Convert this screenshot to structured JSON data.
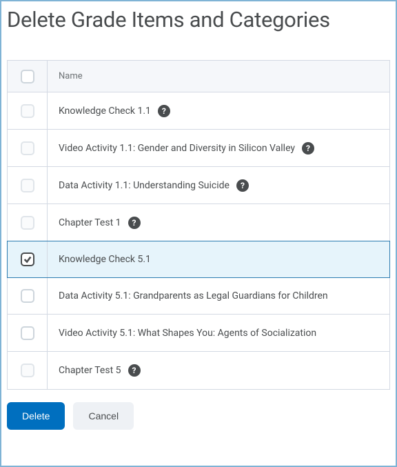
{
  "title": "Delete Grade Items and Categories",
  "table": {
    "header": {
      "name_label": "Name"
    },
    "rows": [
      {
        "label": "Knowledge Check 1.1",
        "checked": false,
        "disabled": true,
        "help": true
      },
      {
        "label": "Video Activity 1.1: Gender and Diversity in Silicon Valley",
        "checked": false,
        "disabled": true,
        "help": true
      },
      {
        "label": "Data Activity 1.1: Understanding Suicide",
        "checked": false,
        "disabled": true,
        "help": true
      },
      {
        "label": "Chapter Test 1",
        "checked": false,
        "disabled": true,
        "help": true
      },
      {
        "label": "Knowledge Check 5.1",
        "checked": true,
        "disabled": false,
        "help": false
      },
      {
        "label": "Data Activity 5.1: Grandparents as Legal Guardians for Children",
        "checked": false,
        "disabled": false,
        "help": false
      },
      {
        "label": "Video Activity 5.1: What Shapes You: Agents of Socialization",
        "checked": false,
        "disabled": false,
        "help": false
      },
      {
        "label": "Chapter Test 5",
        "checked": false,
        "disabled": true,
        "help": true
      }
    ]
  },
  "buttons": {
    "delete_label": "Delete",
    "cancel_label": "Cancel"
  }
}
